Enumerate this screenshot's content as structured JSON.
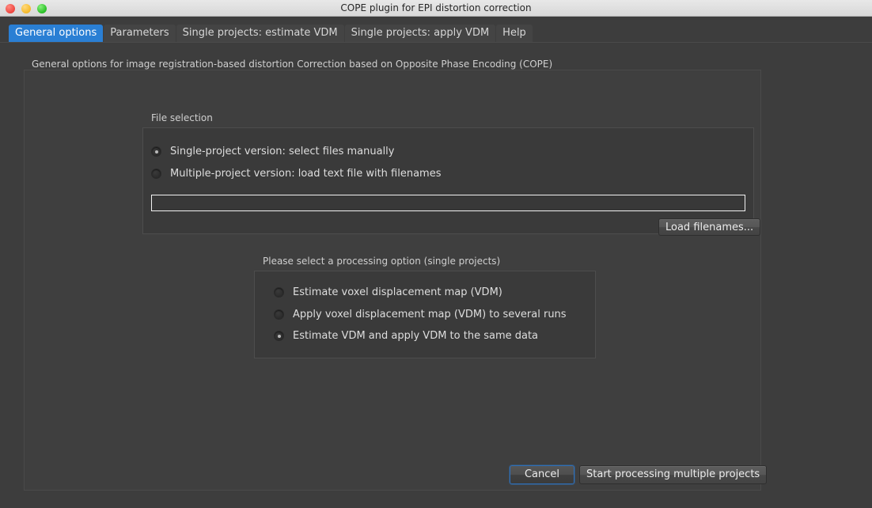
{
  "window": {
    "title": "COPE plugin for EPI distortion correction",
    "traffic_lights": [
      "close",
      "minimize",
      "maximize"
    ]
  },
  "tabs": [
    {
      "label": "General options",
      "active": true
    },
    {
      "label": "Parameters",
      "active": false
    },
    {
      "label": "Single projects: estimate VDM",
      "active": false
    },
    {
      "label": "Single projects: apply VDM",
      "active": false
    },
    {
      "label": "Help",
      "active": false
    }
  ],
  "main": {
    "section_caption": "General options for image registration-based distortion Correction based on Opposite Phase Encoding (COPE)",
    "file_selection": {
      "title": "File selection",
      "options": [
        {
          "label": "Single-project version: select files manually",
          "checked": true
        },
        {
          "label": "Multiple-project version: load text file with filenames",
          "checked": false
        }
      ],
      "filenames_input": {
        "value": "",
        "placeholder": ""
      },
      "load_button_label": "Load filenames..."
    },
    "processing": {
      "title": "Please select a processing option (single projects)",
      "options": [
        {
          "label": "Estimate voxel displacement map (VDM)",
          "checked": false
        },
        {
          "label": "Apply voxel displacement map (VDM) to several runs",
          "checked": false
        },
        {
          "label": "Estimate VDM and apply VDM to the same data",
          "checked": true
        }
      ]
    },
    "actions": {
      "cancel_label": "Cancel",
      "start_label": "Start processing multiple projects"
    }
  },
  "colors": {
    "window_background": "#3d3d3d",
    "panel_background": "#3f3f3f",
    "group_background": "#3a3a3a",
    "accent_tab": "#2a7fd4",
    "focus_ring": "#2f6fb8",
    "text_primary": "#dedede",
    "text_secondary": "#cfcfcf",
    "titlebar": "#e0e0e0"
  }
}
